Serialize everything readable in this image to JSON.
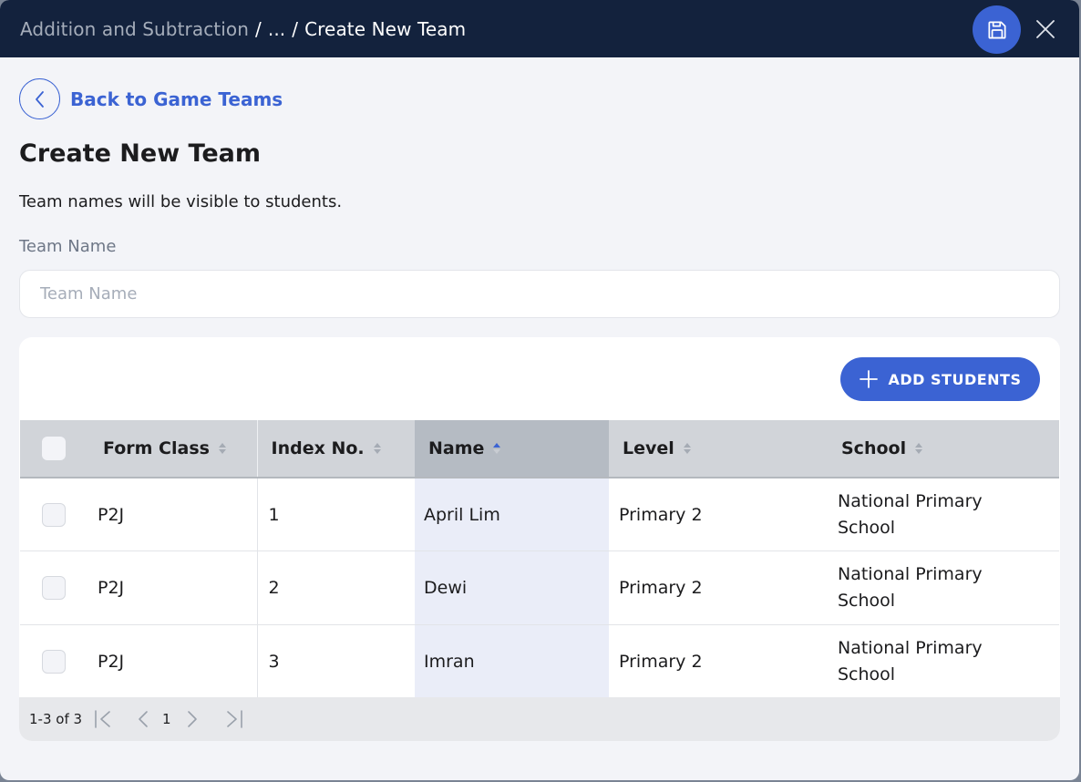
{
  "header": {
    "breadcrumb": [
      "Addition and Subtraction",
      "...",
      "Create New Team"
    ],
    "separator": "/",
    "save_icon": "floppy-disk-icon",
    "close_icon": "close-x-icon"
  },
  "back_link": {
    "label": "Back to Game Teams",
    "icon": "chevron-left-icon"
  },
  "page": {
    "title": "Create New Team",
    "subtitle": "Team names will be visible to students.",
    "team_name_label": "Team Name",
    "team_name_placeholder": "Team Name",
    "team_name_value": ""
  },
  "table": {
    "add_button_label": "ADD STUDENTS",
    "add_button_icon": "plus-icon",
    "columns": [
      {
        "label": "Form Class",
        "sort": "none"
      },
      {
        "label": "Index No.",
        "sort": "none"
      },
      {
        "label": "Name",
        "sort": "ascending"
      },
      {
        "label": "Level",
        "sort": "none"
      },
      {
        "label": "School",
        "sort": "none"
      }
    ],
    "rows": [
      {
        "form_class": "P2J",
        "index_no": "1",
        "name": "April Lim",
        "level": "Primary 2",
        "school": "National Primary School",
        "checked": false
      },
      {
        "form_class": "P2J",
        "index_no": "2",
        "name": "Dewi",
        "level": "Primary 2",
        "school": "National Primary School",
        "checked": false
      },
      {
        "form_class": "P2J",
        "index_no": "3",
        "name": "Imran",
        "level": "Primary 2",
        "school": "National Primary School",
        "checked": false
      }
    ],
    "pagination": {
      "range_text": "1-3 of 3",
      "current_page": "1"
    }
  },
  "colors": {
    "accent": "#3b63d3",
    "header_bg": "#13223d",
    "page_bg": "#f3f4f8"
  }
}
